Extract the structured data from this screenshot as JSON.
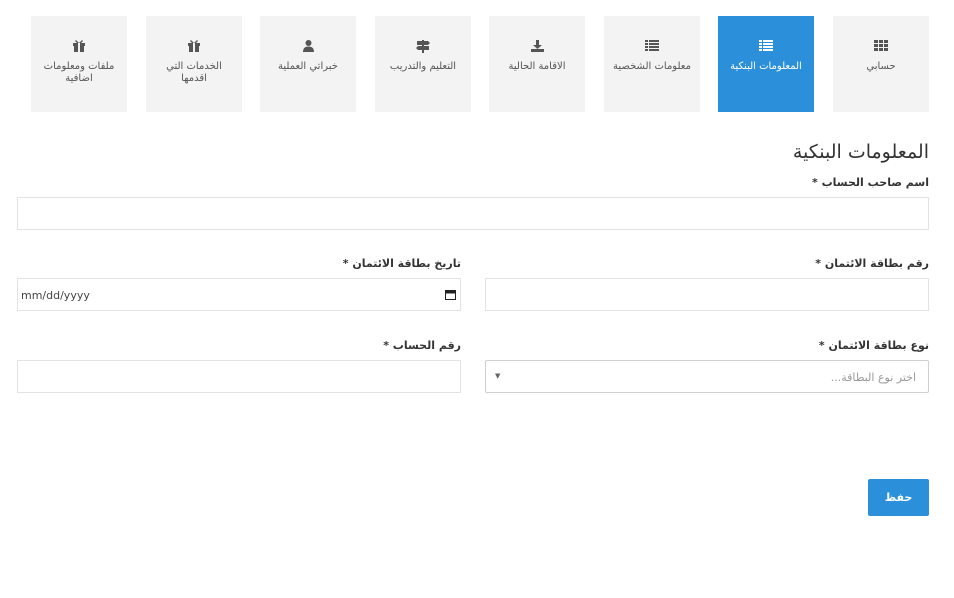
{
  "tabs": [
    {
      "label": "حسابي",
      "icon": "grid-icon",
      "active": false
    },
    {
      "label": "المعلومات البنكية",
      "icon": "list-icon",
      "active": true
    },
    {
      "label": "معلومات الشخصية",
      "icon": "list-icon",
      "active": false
    },
    {
      "label": "الاقامة الحالية",
      "icon": "download-icon",
      "active": false
    },
    {
      "label": "التعليم والتدريب",
      "icon": "signpost-icon",
      "active": false
    },
    {
      "label": "خبراتي العملية",
      "icon": "user-icon",
      "active": false
    },
    {
      "label": "الخدمات التي اقدمها",
      "icon": "gift-icon",
      "active": false
    },
    {
      "label": "ملفات ومعلومات اضافية",
      "icon": "gift-icon",
      "active": false
    }
  ],
  "form": {
    "title": "المعلومات البنكية",
    "account_holder": {
      "label": "اسم صاحب الحساب *",
      "value": ""
    },
    "card_number": {
      "label": "رقم بطاقة الائتمان *",
      "value": ""
    },
    "card_date": {
      "label": "تاريخ بطاقة الائتمان *",
      "placeholder": "mm/dd/yyyy"
    },
    "card_type": {
      "label": "نوع بطاقة الائتمان *",
      "placeholder": "اختر نوع البطاقة..."
    },
    "account_number": {
      "label": "رقم الحساب *",
      "value": ""
    },
    "save_label": "حفظ"
  },
  "colors": {
    "accent": "#2b90d9",
    "tab_bg": "#f3f3f3",
    "border": "#e3e3e3"
  }
}
